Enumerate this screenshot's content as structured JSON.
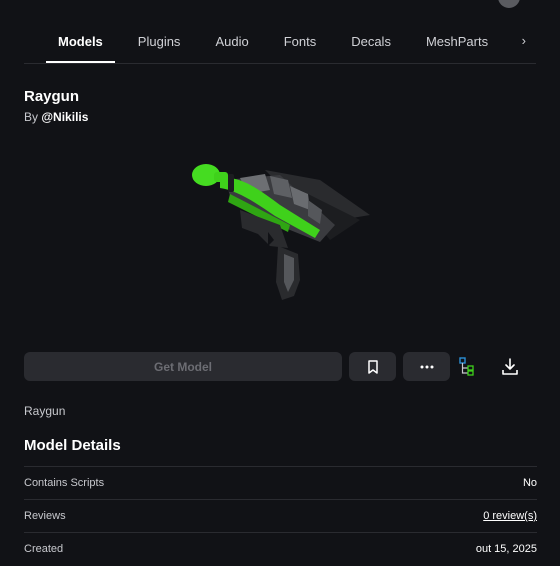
{
  "tabs": [
    {
      "label": "Models",
      "active": true
    },
    {
      "label": "Plugins"
    },
    {
      "label": "Audio"
    },
    {
      "label": "Fonts"
    },
    {
      "label": "Decals"
    },
    {
      "label": "MeshParts"
    }
  ],
  "tabs_more_icon": "chevron-right-icon",
  "asset": {
    "title": "Raygun",
    "by_prefix": "By",
    "creator": "@Nikilis",
    "description": "Raygun"
  },
  "actions": {
    "get_model": "Get Model",
    "bookmark_icon": "bookmark-icon",
    "more_icon": "ellipsis-icon",
    "hierarchy_icon": "hierarchy-icon",
    "download_icon": "download-icon"
  },
  "details": {
    "title": "Model Details",
    "rows": [
      {
        "key": "Contains Scripts",
        "value": "No"
      },
      {
        "key": "Reviews",
        "value": "0 review(s)"
      },
      {
        "key": "Created",
        "value": "out 15, 2025"
      }
    ]
  },
  "colors": {
    "background": "#111216",
    "button_bg": "#2a2b30",
    "accent_green": "#3fd11b"
  }
}
